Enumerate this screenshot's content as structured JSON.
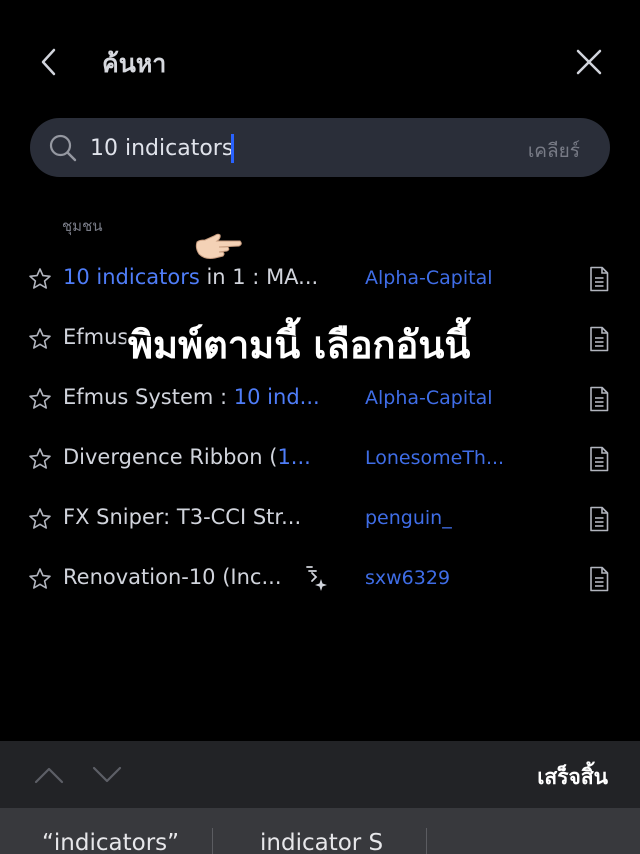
{
  "header": {
    "title": "ค้นหา"
  },
  "search": {
    "value": "10 indicators",
    "clear_label": "เคลียร์"
  },
  "section": {
    "label": "ชุมชน"
  },
  "results": [
    {
      "pre": "",
      "highlight": "10 indicators",
      "post": " in 1 : MA...",
      "author": "Alpha-Capital",
      "editors_pick": false
    },
    {
      "pre": "Efmus ",
      "highlight": "",
      "post": "",
      "author": "",
      "editors_pick": false
    },
    {
      "pre": "Efmus System : ",
      "highlight": "10 ind...",
      "post": "",
      "author": "Alpha-Capital",
      "editors_pick": false
    },
    {
      "pre": "Divergence Ribbon (",
      "highlight": "1...",
      "post": "",
      "author": "LonesomeTh...",
      "editors_pick": false
    },
    {
      "pre": "FX Sniper: T3-CCI Str...",
      "highlight": "",
      "post": "",
      "author": "penguin_",
      "editors_pick": false
    },
    {
      "pre": "Renovation-10 (Inc...",
      "highlight": "",
      "post": "",
      "author": "sxw6329",
      "editors_pick": true
    }
  ],
  "overlay": {
    "caption": "พิมพ์ตามนี้ เลือกอันนี้"
  },
  "toolbar": {
    "done_label": "เสร็จสิ้น"
  },
  "suggestions": [
    "“indicators”",
    "indicator S"
  ],
  "icons": [
    "back-icon",
    "close-icon",
    "search-icon",
    "star-icon",
    "document-icon",
    "editors-pick-icon",
    "pointing-hand-icon",
    "chevron-up-icon",
    "chevron-down-icon"
  ],
  "colors": {
    "background": "#000000",
    "accent": "#2962ff",
    "highlight": "#4f7df8",
    "author": "#3f6de6",
    "search_bg": "#2a2e39",
    "toolbar_bg": "#222326",
    "suggest_bg": "#38393d"
  }
}
